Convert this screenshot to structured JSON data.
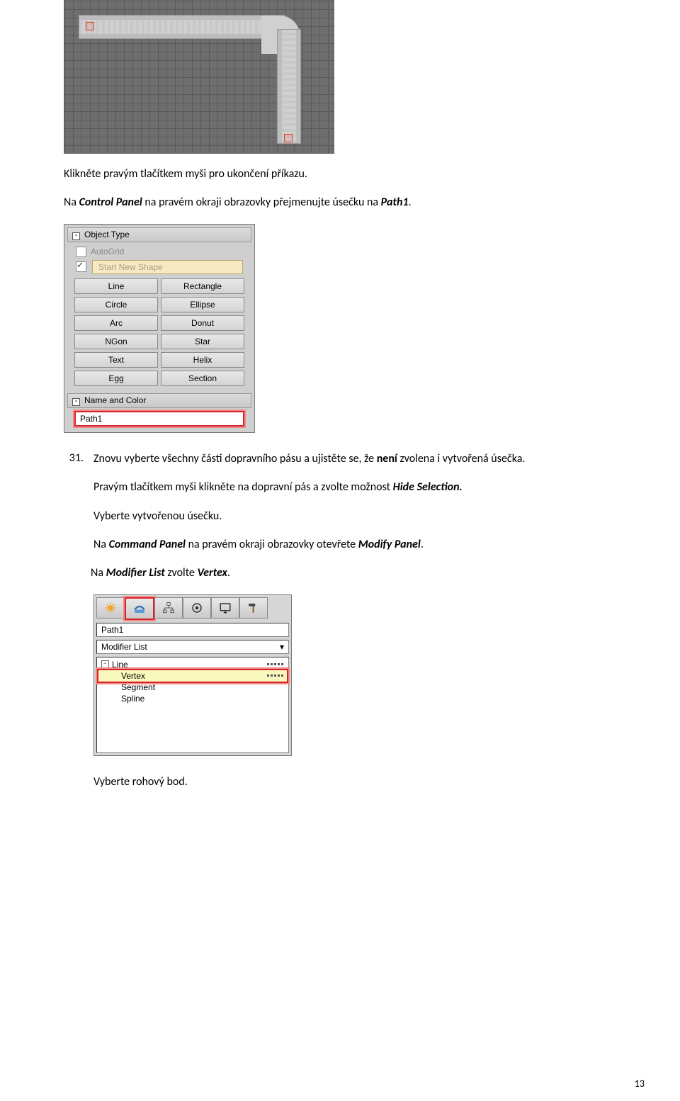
{
  "para1": "Klikněte pravým tlačítkem myši pro ukončení příkazu.",
  "para2_a": "Na ",
  "para2_b": "Control Panel",
  "para2_c": " na pravém okraji obrazovky  přejmenujte úsečku na ",
  "para2_d": "Path1",
  "para2_e": ".",
  "panel": {
    "objtype": "Object Type",
    "autogrid": "AutoGrid",
    "startnew": "Start New Shape",
    "buttons": [
      "Line",
      "Rectangle",
      "Circle",
      "Ellipse",
      "Arc",
      "Donut",
      "NGon",
      "Star",
      "Text",
      "Helix",
      "Egg",
      "Section"
    ],
    "namecolor": "Name and Color",
    "nameval": "Path1"
  },
  "step": {
    "num": "31.",
    "l1a": "Znovu vyberte všechny části dopravního pásu a ujistěte se, že ",
    "l1b": "není",
    "l1c": " zvolena i vytvořená úsečka.",
    "l2a": "Pravým tlačítkem myši klikněte na dopravní pás a zvolte možnost ",
    "l2b": "Hide Selection.",
    "l3": "Vyberte vytvořenou úsečku.",
    "l4a": "Na ",
    "l4b": "Command Panel",
    "l4c": " na pravém okraji obrazovky otevřete ",
    "l4d": "Modify Panel",
    "l4e": ".",
    "l5a": "Na ",
    "l5b": "Modifier List",
    "l5c": " zvolte  ",
    "l5d": "Vertex",
    "l5e": "."
  },
  "cmdpanel": {
    "name": "Path1",
    "modlist": "Modifier List",
    "tree": [
      "Line",
      "Vertex",
      "Segment",
      "Spline"
    ]
  },
  "final": "Vyberte rohový bod.",
  "pagenum": "13"
}
